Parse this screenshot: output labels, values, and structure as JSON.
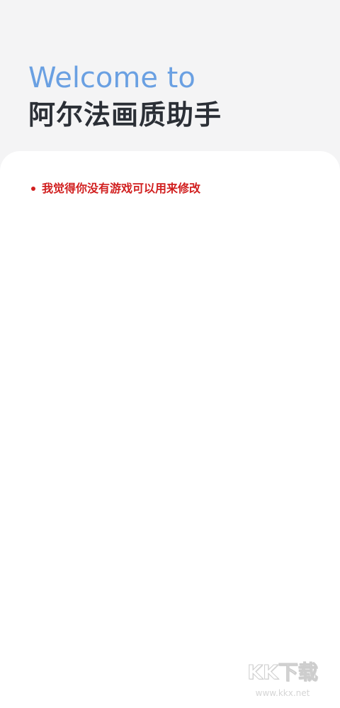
{
  "header": {
    "welcome_label": "Welcome to",
    "app_name": "阿尔法画质助手"
  },
  "main": {
    "notice": "我觉得你没有游戏可以用来修改"
  },
  "watermark": {
    "title": "KK下载",
    "url": "www.kkx.net"
  }
}
